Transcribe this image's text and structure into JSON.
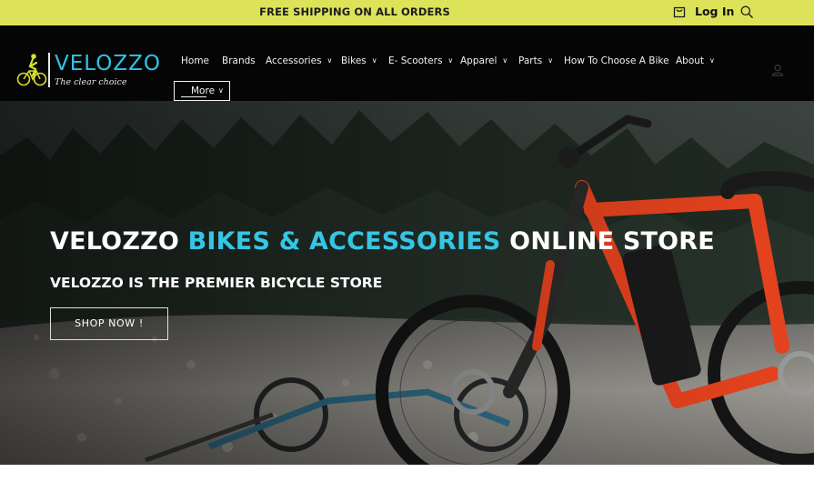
{
  "announcement": {
    "text": "FREE SHIPPING ON ALL ORDERS",
    "bg_color": "#dde359"
  },
  "header_actions": {
    "login_label": "Log In",
    "cart_icon": "cart-icon",
    "search_icon": "search-icon",
    "account_icon": "account-icon"
  },
  "logo": {
    "wordmark": "VELOZZO",
    "tagline": "The clear choice",
    "wordmark_color": "#2ec4e8",
    "mark_color": "#d7e02c"
  },
  "nav": {
    "items": [
      {
        "label": "Home",
        "has_dropdown": false,
        "active": true
      },
      {
        "label": "Brands",
        "has_dropdown": false
      },
      {
        "label": "Accessories",
        "has_dropdown": true
      },
      {
        "label": "Bikes",
        "has_dropdown": true
      },
      {
        "label": "E- Scooters",
        "has_dropdown": true
      },
      {
        "label": "Apparel",
        "has_dropdown": true
      },
      {
        "label": "Parts",
        "has_dropdown": true
      },
      {
        "label": "How To Choose A Bike",
        "has_dropdown": false
      },
      {
        "label": "About",
        "has_dropdown": true
      }
    ],
    "more_label": "More"
  },
  "hero": {
    "title_part1": "VELOZZO ",
    "title_accent": "BIKES & ACCESSORIES",
    "title_part2": " ONLINE STORE",
    "subtitle": "VELOZZO IS THE PREMIER BICYCLE STORE",
    "cta_label": "SHOP NOW !",
    "accent_color": "#35c6e4",
    "bike_color": "#e8431e"
  }
}
